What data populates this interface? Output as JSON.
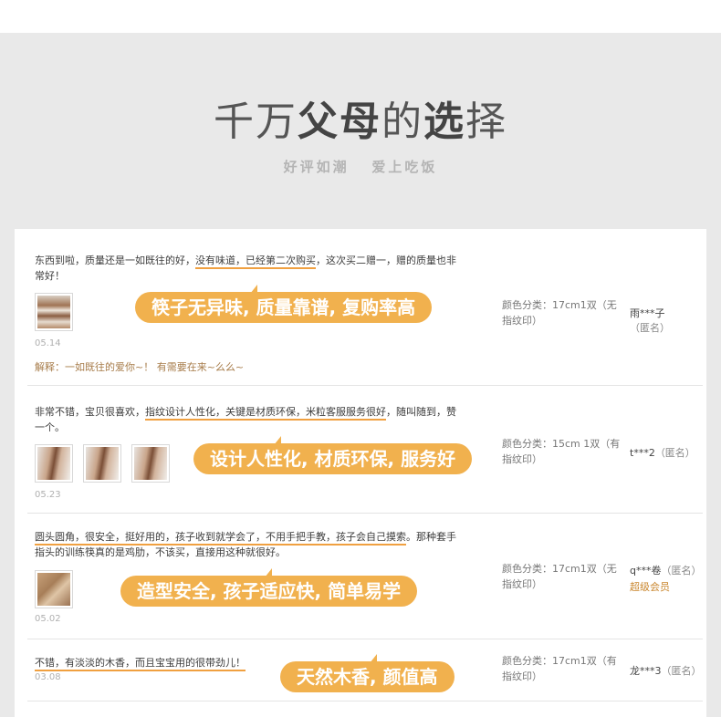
{
  "header": {
    "title_parts": [
      "千万",
      "父母",
      "的",
      "选",
      "择"
    ],
    "subtitle": "好评如潮   爱上吃饭"
  },
  "reviews": [
    {
      "text_a": "东西到啦，质量还是一如既往的好，",
      "text_ul": "没有味道，已经第二次购买",
      "text_b": "，这次买二赠一，赠的质量也非常好！",
      "date": "05.14",
      "reply": "解释：一如既往的爱你~！ 有需要在来~么么~",
      "bubble": "筷子无异味, 质量靠谱, 复购率高",
      "sku": "颜色分类：17cm1双（无指纹印）",
      "user": "雨***子",
      "anon": "（匿名）"
    },
    {
      "text_a": "非常不错，宝贝很喜欢，",
      "text_ul": "指纹设计人性化，关键是材质环保，米粒客服服务很好",
      "text_b": "，随叫随到，赞一个。",
      "date": "05.23",
      "bubble": "设计人性化, 材质环保, 服务好",
      "sku": "颜色分类：15cm 1双（有指纹印）",
      "user": "t***2",
      "anon": "（匿名）"
    },
    {
      "text_ul": "圆头圆角，很安全，挺好用的，孩子收到就学会了，不用手把手教，孩子会自己摸索",
      "text_b": "。那种套手指头的训练筷真的是鸡肋，不该买，直接用这种就很好。",
      "date": "05.02",
      "bubble": "造型安全, 孩子适应快, 简单易学",
      "sku": "颜色分类：17cm1双（无指纹印）",
      "user": "q***卷",
      "anon": "（匿名）",
      "vip": "超级会员"
    },
    {
      "text_ul": "不错，有淡淡的木香，而且宝宝用的很带劲儿！",
      "date": "03.08",
      "bubble": "天然木香, 颜值高",
      "sku": "颜色分类：17cm1双（有指纹印）",
      "user": "龙***3",
      "anon": "（匿名）"
    }
  ],
  "colors": {
    "accent": "#f1b14e",
    "underline": "#f0a040",
    "background": "#e9e9e9"
  }
}
